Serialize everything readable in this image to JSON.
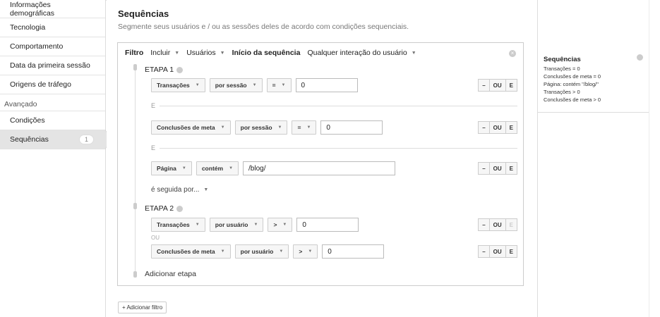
{
  "sidebar": {
    "items": [
      {
        "label": "Informações demográficas"
      },
      {
        "label": "Tecnologia"
      },
      {
        "label": "Comportamento"
      },
      {
        "label": "Data da primeira sessão"
      },
      {
        "label": "Origens de tráfego"
      }
    ],
    "advanced_header": "Avançado",
    "advanced_items": [
      {
        "label": "Condições"
      },
      {
        "label": "Sequências",
        "badge": "1"
      }
    ]
  },
  "main": {
    "title": "Sequências",
    "subtitle": "Segmente seus usuários e / ou as sessões deles de acordo com condições sequenciais.",
    "filter": {
      "label": "Filtro",
      "include": "Incluir",
      "users": "Usuários",
      "sequence_start_label": "Início da sequência",
      "sequence_start_value": "Qualquer interação do usuário"
    },
    "step1": {
      "label": "ETAPA 1",
      "conditions": [
        {
          "dim": "Transações",
          "scope": "por sessão",
          "op": "=",
          "value": "0"
        },
        {
          "dim": "Conclusões de meta",
          "scope": "por sessão",
          "op": "=",
          "value": "0"
        },
        {
          "dim": "Página",
          "op": "contém",
          "value": "/blog/"
        }
      ],
      "and_label": "E",
      "followed_by": "é seguida por..."
    },
    "step2": {
      "label": "ETAPA 2",
      "conditions": [
        {
          "dim": "Transações",
          "scope": "por usuário",
          "op": ">",
          "value": "0"
        },
        {
          "dim": "Conclusões de meta",
          "scope": "por usuário",
          "op": ">",
          "value": "0"
        }
      ],
      "or_label": "OU"
    },
    "buttons": {
      "minus": "–",
      "or": "OU",
      "and": "E"
    },
    "add_step": "Adicionar etapa",
    "add_filter": "+ Adicionar filtro"
  },
  "summary": {
    "title": "Sequências",
    "lines": [
      "Transações = 0",
      "Conclusões de meta = 0",
      "Página: contém \"/blog/\"",
      "Transações > 0",
      "Conclusões de meta > 0"
    ]
  }
}
